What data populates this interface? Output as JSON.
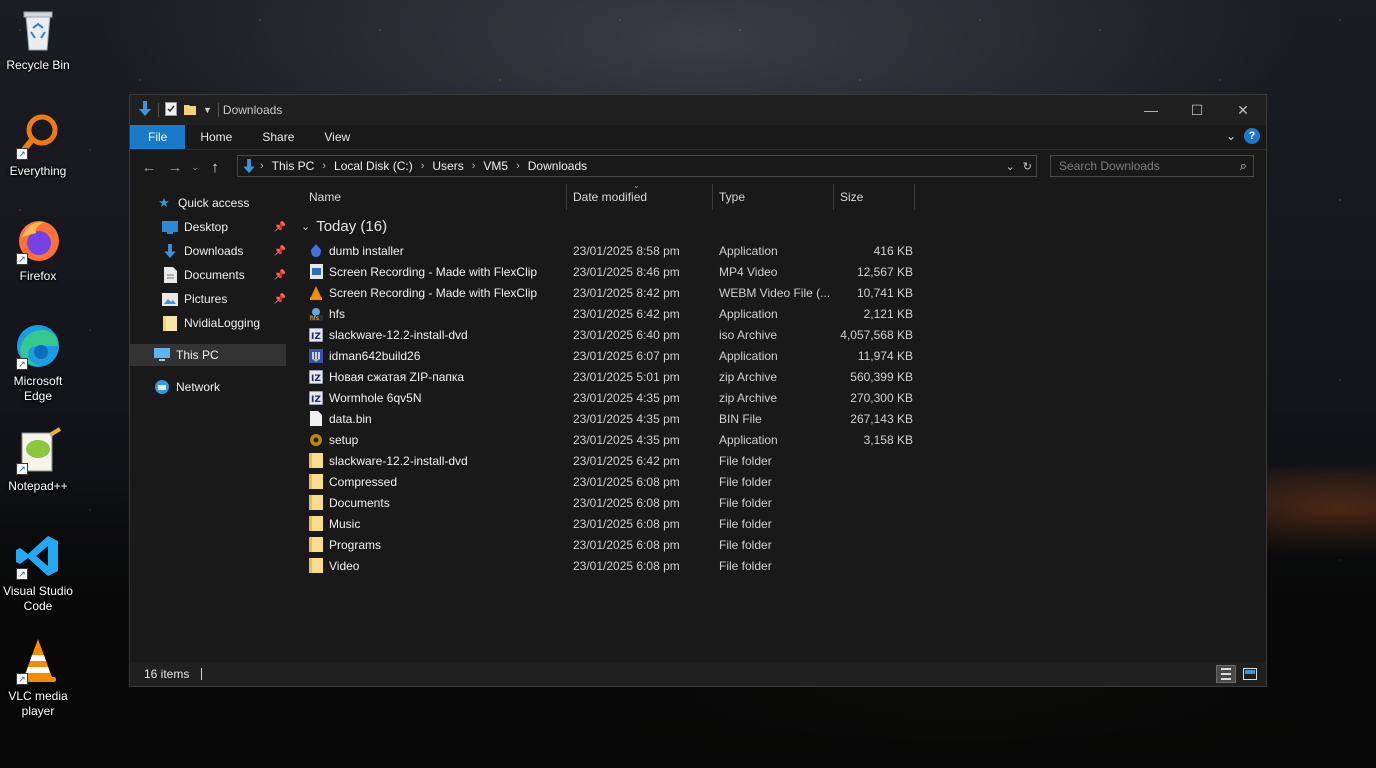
{
  "desktop": {
    "icons": [
      {
        "label": "Recycle Bin",
        "icon": "recycle-bin-icon"
      },
      {
        "label": "Everything",
        "icon": "everything-search-icon"
      },
      {
        "label": "Firefox",
        "icon": "firefox-icon"
      },
      {
        "label": "Microsoft Edge",
        "icon": "edge-icon"
      },
      {
        "label": "Notepad++",
        "icon": "notepad-plus-plus-icon"
      },
      {
        "label": "Visual Studio Code",
        "icon": "vscode-icon"
      },
      {
        "label": "VLC media player",
        "icon": "vlc-icon"
      }
    ]
  },
  "window": {
    "title": "Downloads",
    "controls": {
      "minimize": "—",
      "maximize": "☐",
      "close": "✕"
    }
  },
  "ribbon": {
    "tabs": [
      "File",
      "Home",
      "Share",
      "View"
    ],
    "help": "?"
  },
  "address": {
    "breadcrumbs": [
      "This PC",
      "Local Disk (C:)",
      "Users",
      "VM5",
      "Downloads"
    ]
  },
  "search": {
    "placeholder": "Search Downloads"
  },
  "navpane": {
    "quick_access": "Quick access",
    "items": [
      {
        "label": "Desktop",
        "pinned": true
      },
      {
        "label": "Downloads",
        "pinned": true
      },
      {
        "label": "Documents",
        "pinned": true
      },
      {
        "label": "Pictures",
        "pinned": true
      },
      {
        "label": "NvidiaLogging",
        "pinned": false
      }
    ],
    "this_pc": "This PC",
    "network": "Network"
  },
  "columns": {
    "name": "Name",
    "date": "Date modified",
    "type": "Type",
    "size": "Size"
  },
  "group": {
    "label": "Today (16)"
  },
  "files": [
    {
      "name": "dumb installer",
      "date": "23/01/2025 8:58 pm",
      "type": "Application",
      "size": "416 KB",
      "icon": "installer-icon"
    },
    {
      "name": "Screen Recording - Made with FlexClip",
      "date": "23/01/2025 8:46 pm",
      "type": "MP4 Video",
      "size": "12,567 KB",
      "icon": "video-file-icon"
    },
    {
      "name": "Screen Recording - Made with FlexClip",
      "date": "23/01/2025 8:42 pm",
      "type": "WEBM Video File (...",
      "size": "10,741 KB",
      "icon": "vlc-file-icon"
    },
    {
      "name": "hfs",
      "date": "23/01/2025 6:42 pm",
      "type": "Application",
      "size": "2,121 KB",
      "icon": "hfs-app-icon"
    },
    {
      "name": "slackware-12.2-install-dvd",
      "date": "23/01/2025 6:40 pm",
      "type": "iso Archive",
      "size": "4,057,568 KB",
      "icon": "archive-icon"
    },
    {
      "name": "idman642build26",
      "date": "23/01/2025 6:07 pm",
      "type": "Application",
      "size": "11,974 KB",
      "icon": "idm-installer-icon"
    },
    {
      "name": "Новая сжатая ZIP-папка",
      "date": "23/01/2025 5:01 pm",
      "type": "zip Archive",
      "size": "560,399 KB",
      "icon": "archive-icon"
    },
    {
      "name": "Wormhole 6qv5N",
      "date": "23/01/2025 4:35 pm",
      "type": "zip Archive",
      "size": "270,300 KB",
      "icon": "archive-icon"
    },
    {
      "name": "data.bin",
      "date": "23/01/2025 4:35 pm",
      "type": "BIN File",
      "size": "267,143 KB",
      "icon": "blank-file-icon"
    },
    {
      "name": "setup",
      "date": "23/01/2025 4:35 pm",
      "type": "Application",
      "size": "3,158 KB",
      "icon": "setup-icon"
    },
    {
      "name": "slackware-12.2-install-dvd",
      "date": "23/01/2025 6:42 pm",
      "type": "File folder",
      "size": "",
      "icon": "folder-icon"
    },
    {
      "name": "Compressed",
      "date": "23/01/2025 6:08 pm",
      "type": "File folder",
      "size": "",
      "icon": "folder-icon"
    },
    {
      "name": "Documents",
      "date": "23/01/2025 6:08 pm",
      "type": "File folder",
      "size": "",
      "icon": "folder-icon"
    },
    {
      "name": "Music",
      "date": "23/01/2025 6:08 pm",
      "type": "File folder",
      "size": "",
      "icon": "folder-icon"
    },
    {
      "name": "Programs",
      "date": "23/01/2025 6:08 pm",
      "type": "File folder",
      "size": "",
      "icon": "folder-icon"
    },
    {
      "name": "Video",
      "date": "23/01/2025 6:08 pm",
      "type": "File folder",
      "size": "",
      "icon": "folder-icon"
    }
  ],
  "status": {
    "count": "16 items",
    "caret": "|"
  },
  "colors": {
    "accent": "#1979ca",
    "window_bg": "#191919",
    "folder": "#f3d27a"
  }
}
